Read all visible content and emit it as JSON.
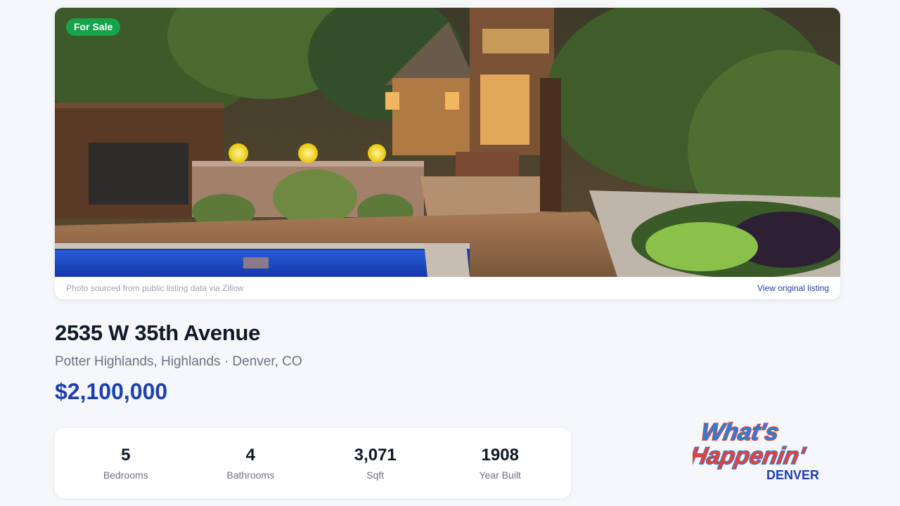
{
  "listing": {
    "badge": "For Sale",
    "photo_caption": "Photo sourced from public listing data via Zillow",
    "photo_link": "View original listing",
    "address": "2535 W 35th Avenue",
    "location": "Potter Highlands, Highlands · Denver, CO",
    "price": "$2,100,000",
    "stats": [
      {
        "value": "5",
        "label": "Bedrooms"
      },
      {
        "value": "4",
        "label": "Bathrooms"
      },
      {
        "value": "3,071",
        "label": "Sqft"
      },
      {
        "value": "1908",
        "label": "Year Built"
      }
    ]
  },
  "logo": {
    "line1": "What's",
    "line2": "Happenin'",
    "line3": "DENVER"
  },
  "colors": {
    "accent": "#1e40af",
    "badge": "#16a34a",
    "logo_blue": "#2b7fd9",
    "logo_red": "#e0433a"
  }
}
